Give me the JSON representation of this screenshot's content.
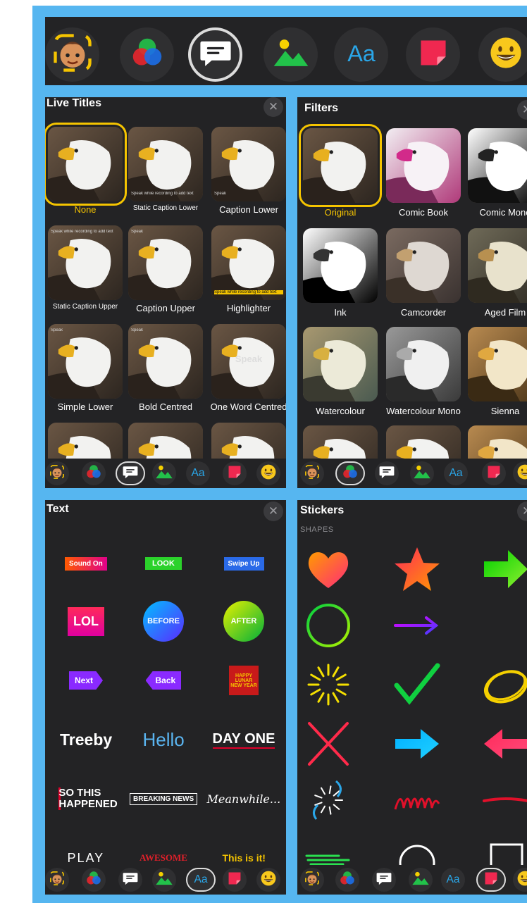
{
  "toolbar": {
    "items": [
      {
        "name": "memoji",
        "icon": "memoji-icon"
      },
      {
        "name": "filters",
        "icon": "filters-icon"
      },
      {
        "name": "live-titles",
        "icon": "speech-bubble-icon",
        "selected": true
      },
      {
        "name": "posters",
        "icon": "landscape-icon"
      },
      {
        "name": "text",
        "icon": "text-icon",
        "label": "Aa"
      },
      {
        "name": "stickers",
        "icon": "sticker-icon"
      },
      {
        "name": "emoji",
        "icon": "emoji-icon"
      }
    ]
  },
  "live_titles": {
    "title": "Live Titles",
    "close": "✕",
    "items": [
      {
        "label": "None",
        "selected": true,
        "overlay": ""
      },
      {
        "label": "Static Caption Lower",
        "overlay": "Speak while recording to add text"
      },
      {
        "label": "Caption Lower",
        "overlay": "Speak"
      },
      {
        "label": "Static Caption Upper",
        "overlay": "Speak while recording to add text"
      },
      {
        "label": "Caption Upper",
        "overlay": "Speak"
      },
      {
        "label": "Highlighter",
        "overlay": "Speak while recording to add text"
      },
      {
        "label": "Simple Lower",
        "overlay": "Speak"
      },
      {
        "label": "Bold Centred",
        "overlay": "Speak"
      },
      {
        "label": "One Word Centred",
        "overlay": "Speak"
      },
      {
        "label": "",
        "overlay": ""
      },
      {
        "label": "",
        "overlay": ""
      },
      {
        "label": "",
        "overlay": ""
      }
    ]
  },
  "filters": {
    "title": "Filters",
    "close": "✕",
    "items": [
      {
        "label": "Original",
        "selected": true,
        "style": "orig"
      },
      {
        "label": "Comic Book",
        "style": "comic"
      },
      {
        "label": "Comic Mono",
        "style": "mono"
      },
      {
        "label": "Ink",
        "style": "ink"
      },
      {
        "label": "Camcorder",
        "style": "cam"
      },
      {
        "label": "Aged Film",
        "style": "aged"
      },
      {
        "label": "Watercolour",
        "style": "water"
      },
      {
        "label": "Watercolour Mono",
        "style": "wmono"
      },
      {
        "label": "Sienna",
        "style": "sienna"
      },
      {
        "label": "",
        "style": "orig"
      },
      {
        "label": "",
        "style": "orig"
      },
      {
        "label": "",
        "style": "sienna"
      }
    ]
  },
  "text": {
    "title": "Text",
    "close": "✕",
    "items": [
      "Sound On",
      "LOOK",
      "Swipe Up",
      "LOL",
      "BEFORE",
      "AFTER",
      "Next",
      "Back",
      "HAPPY LUNAR NEW YEAR",
      "Treeby",
      "Hello",
      "DAY ONE",
      "SO THIS HAPPENED",
      "BREAKING NEWS",
      "Meanwhile...",
      "PLAY",
      "AWESOME",
      "This is it!"
    ]
  },
  "stickers": {
    "title": "Stickers",
    "close": "✕",
    "section": "SHAPES",
    "items": [
      "heart-icon",
      "star-icon",
      "arrow-right-icon",
      "circle-icon",
      "thin-arrow-icon",
      "line-icon",
      "burst-icon",
      "checkmark-icon",
      "scribble-circle-icon",
      "cross-icon",
      "arrow-right-blue-icon",
      "arrow-left-icon",
      "dotted-burst-icon",
      "scribble-icon",
      "brush-line-icon",
      "brush-stroke-icon",
      "outline-circle-icon",
      "outline-square-icon"
    ]
  },
  "colors": {
    "selected_yellow": "#f5c400",
    "panel_bg": "#232325",
    "frame_blue": "#56b6f0"
  }
}
